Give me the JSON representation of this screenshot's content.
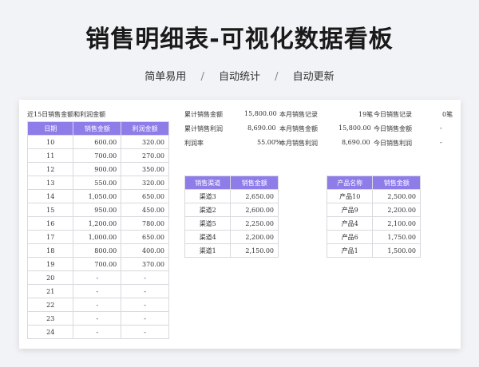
{
  "title": "销售明细表-可视化数据看板",
  "tagline": [
    "简单易用",
    "自动统计",
    "自动更新"
  ],
  "tagline_sep": "/",
  "section_label": "近15日销售金额和利润金额",
  "daily_table": {
    "headers": [
      "日期",
      "销售金额",
      "利润金额"
    ],
    "rows": [
      [
        "10",
        "600.00",
        "320.00"
      ],
      [
        "11",
        "700.00",
        "270.00"
      ],
      [
        "12",
        "900.00",
        "350.00"
      ],
      [
        "13",
        "550.00",
        "320.00"
      ],
      [
        "14",
        "1,050.00",
        "650.00"
      ],
      [
        "15",
        "950.00",
        "450.00"
      ],
      [
        "16",
        "1,200.00",
        "780.00"
      ],
      [
        "17",
        "1,000.00",
        "650.00"
      ],
      [
        "18",
        "800.00",
        "400.00"
      ],
      [
        "19",
        "700.00",
        "370.00"
      ],
      [
        "20",
        "-",
        "-"
      ],
      [
        "21",
        "-",
        "-"
      ],
      [
        "22",
        "-",
        "-"
      ],
      [
        "23",
        "-",
        "-"
      ],
      [
        "24",
        "-",
        "-"
      ]
    ]
  },
  "stats": {
    "total_sales_label": "累计销售金额",
    "total_sales_value": "15,800.00",
    "total_profit_label": "累计销售利润",
    "total_profit_value": "8,690.00",
    "profit_rate_label": "利润率",
    "profit_rate_value": "55.00%",
    "month_records_label": "本月销售记录",
    "month_records_value": "19笔",
    "month_sales_label": "本月销售金额",
    "month_sales_value": "15,800.00",
    "month_profit_label": "本月销售利润",
    "month_profit_value": "8,690.00",
    "today_records_label": "今日销售记录",
    "today_records_value": "0笔",
    "today_sales_label": "今日销售金额",
    "today_sales_value": "-",
    "today_profit_label": "今日销售利润",
    "today_profit_value": "-"
  },
  "channel_table": {
    "headers": [
      "销售渠道",
      "销售金额"
    ],
    "rows": [
      [
        "渠道3",
        "2,650.00"
      ],
      [
        "渠道2",
        "2,600.00"
      ],
      [
        "渠道5",
        "2,250.00"
      ],
      [
        "渠道4",
        "2,200.00"
      ],
      [
        "渠道1",
        "2,150.00"
      ]
    ]
  },
  "product_table": {
    "headers": [
      "产品名称",
      "销售金额"
    ],
    "rows": [
      [
        "产品10",
        "2,500.00"
      ],
      [
        "产品9",
        "2,200.00"
      ],
      [
        "产品4",
        "2,100.00"
      ],
      [
        "产品6",
        "1,750.00"
      ],
      [
        "产品1",
        "1,500.00"
      ]
    ]
  },
  "colors": {
    "header_bg": "#8e7ce8",
    "border": "#d9d9de",
    "page_bg": "#f1f3f6"
  }
}
